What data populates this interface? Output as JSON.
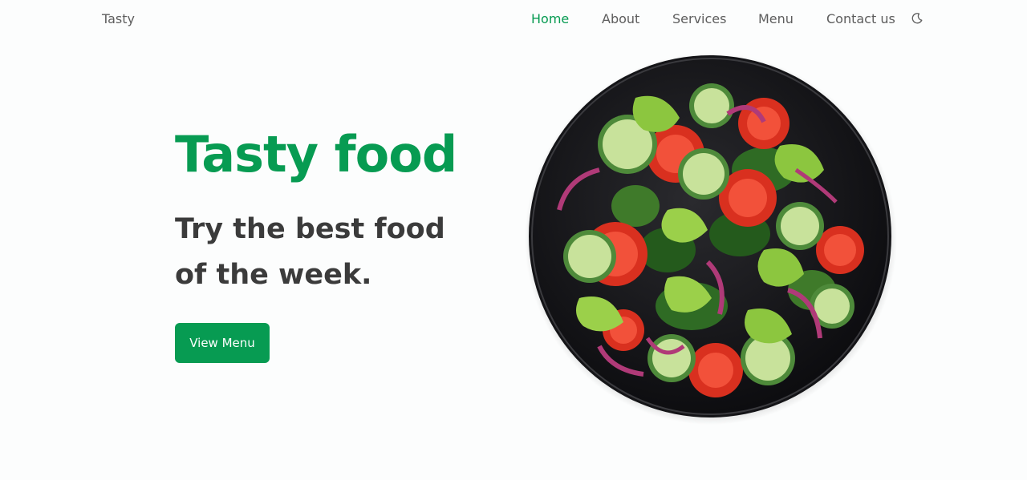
{
  "header": {
    "brand": "Tasty",
    "nav": [
      {
        "label": "Home",
        "active": true
      },
      {
        "label": "About",
        "active": false
      },
      {
        "label": "Services",
        "active": false
      },
      {
        "label": "Menu",
        "active": false
      },
      {
        "label": "Contact us",
        "active": false
      }
    ],
    "theme_icon": "moon-icon"
  },
  "hero": {
    "title": "Tasty food",
    "subtitle": "Try the best food of the week.",
    "cta_label": "View Menu",
    "image": "salad-plate-image"
  },
  "colors": {
    "accent": "#079b52",
    "nav_text": "#5d5d5d",
    "heading_dark": "#3b3b3b",
    "background": "#fcfdfd"
  }
}
